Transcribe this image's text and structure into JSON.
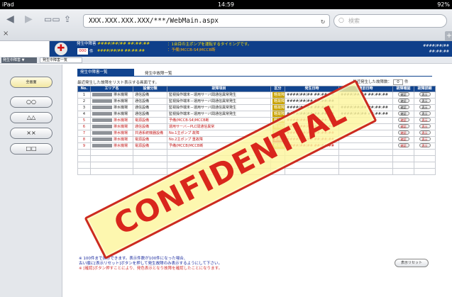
{
  "status_bar": {
    "device": "iPad",
    "time": "14:59",
    "battery": "92%"
  },
  "browser": {
    "url": "XXX.XXX.XXX.XXX/***/WebMain.aspx",
    "search_placeholder": "検索",
    "back_icon": "back-arrow-icon",
    "forward_icon": "forward-arrow-icon",
    "bookmarks_icon": "book-icon",
    "share_icon": "share-icon",
    "reload_icon": "reload-icon",
    "close_label": "×",
    "new_tab_label": "+"
  },
  "header": {
    "alarm_title": "発生中障害",
    "alarm_datetime": "####/##/## ##:##:##",
    "count": "000",
    "count_suffix": "件",
    "message_line1": "：1台目の主ポンプを運転するタイミングです。",
    "message_line2": "：予備(MCCB-S4)MCCB断",
    "right_date": "####/##/##",
    "right_time": "##:##:##"
  },
  "tabrow": {
    "label1": "発生中障害 ▼",
    "label2": "発生中障害一覧"
  },
  "left_menu": [
    "全画面",
    "○○",
    "△△",
    "××",
    "□□"
  ],
  "main": {
    "tab_active": "発生中障害一覧",
    "tab_other": "発生中故障一覧",
    "description": "最近発生した故障をリスト表示する画面です。",
    "recent_label": "最近発生した故障数：",
    "recent_value": "0",
    "recent_unit": "件",
    "columns": [
      "No.",
      "エリア名",
      "設備分類",
      "故障項目",
      "区分",
      "発生日時",
      "復旧日時",
      "故障確認",
      "故障詳細"
    ],
    "rows": [
      {
        "no": "1",
        "area": "排水機場",
        "cls": "通信設備",
        "item": "監視操作端末－運用サーバ間通信異常発生",
        "kubun": "軽故障",
        "occ": "####/##/## ##:##:##",
        "rec": "####/##/## ##:##:##",
        "red": false
      },
      {
        "no": "2",
        "area": "排水機場",
        "cls": "通信設備",
        "item": "監視操作端末－運用サーバ間通信異常発生",
        "kubun": "軽故障",
        "occ": "####/##/## ##:##:##",
        "rec": "",
        "red": false
      },
      {
        "no": "3",
        "area": "排水機場",
        "cls": "通信設備",
        "item": "監視操作端末－運用サーバ間通信異常発生",
        "kubun": "軽故障",
        "occ": "####/##/## ##:##:##",
        "rec": "####/##/## ##:##:##",
        "red": false
      },
      {
        "no": "4",
        "area": "排水機場",
        "cls": "通信設備",
        "item": "監視操作端末－運用サーバ間通信異常発生",
        "kubun": "軽故障",
        "occ": "####/##/## ##:##:##",
        "rec": "####/##/## ##:##:##",
        "red": false
      },
      {
        "no": "5",
        "area": "排水機場",
        "cls": "電源設備",
        "item": "予備(MCCB-S4)MCCB断",
        "kubun": "軽故障",
        "occ": "####/##/## ##:##:##",
        "rec": "",
        "red": true
      },
      {
        "no": "6",
        "area": "排水機場",
        "cls": "通信設備",
        "item": "運用サーバ－PLC間通信異常",
        "kubun": "軽故障",
        "occ": "####/##/## ##:##:##",
        "rec": "",
        "red": true
      },
      {
        "no": "7",
        "area": "排水機場",
        "cls": "共通系統機器設備",
        "item": "No.1主ポンプ 故障",
        "kubun": "軽故障",
        "occ": "####/##/## ##:##:##",
        "rec": "",
        "red": true
      },
      {
        "no": "8",
        "area": "排水機場",
        "cls": "電源設備",
        "item": "No.2主ポンプ 重故障",
        "kubun": "重故障",
        "occ": "####/##/## ##:##:##",
        "rec": "",
        "red": true
      },
      {
        "no": "9",
        "area": "排水機場",
        "cls": "電源設備",
        "item": "予備(MCCB)MCCB断",
        "kubun": "軽故障",
        "occ": "####/##/## ##:##:##",
        "rec": "",
        "red": true
      }
    ],
    "confirm_label": "確認",
    "detail_label": "表示",
    "notes": [
      "※ 100件まで表示できます。表示件数が100件になった場合、",
      "古い順に[表示リセット]ボタンを押して発生故障のみ表示するようにして下さい。",
      "※ [確認]ボタン押すことにより、発色表示となり故障を確認したことになります。"
    ],
    "reset_label": "表示リセット"
  },
  "watermark": "CONFIDENTIAL",
  "colors": {
    "header_bg": "#0f3f8a",
    "table_head": "#11448f",
    "alarm_red": "#c21b1b",
    "stamp_red": "#d9261c",
    "stamp_bg": "#fcf59e"
  }
}
